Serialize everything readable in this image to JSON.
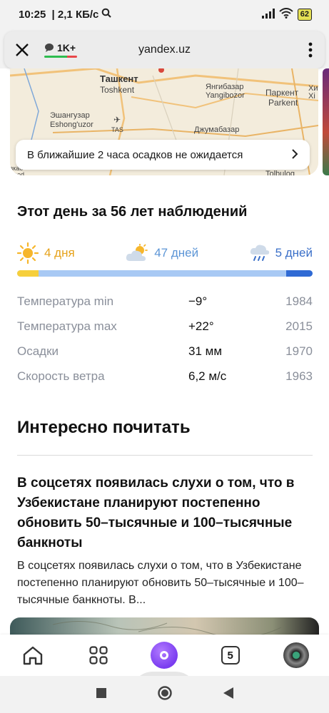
{
  "status_bar": {
    "time": "10:25",
    "speed": "2,1 КБ/с",
    "battery": "62"
  },
  "browser": {
    "comments_count": "1K+",
    "domain": "yandex.uz"
  },
  "map": {
    "labels": {
      "tashkent": "Ташкент",
      "toshkent": "Toshkent",
      "yangibazar": "Янгибазар",
      "yangibozor": "Yangibozor",
      "parkent_ru": "Паркент",
      "parkent": "Parkent",
      "eshangu_ru": "Эшангузар",
      "eshangu": "Eshong'uzor",
      "tas": "TAS",
      "djumabazar": "Джумабазар",
      "xi1": "Хи",
      "xi2": "Xi",
      "kabod": "ɜкаб\nabod",
      "tolbulog": "Tolbulog"
    },
    "precip_text": "В ближайшие 2 часа осадков не ожидается"
  },
  "history": {
    "title": "Этот день за 56 лет наблюдений",
    "stats": [
      {
        "label": "4 дня",
        "kind": "sun",
        "value": 4
      },
      {
        "label": "47 дней",
        "kind": "cloud",
        "value": 47
      },
      {
        "label": "5 дней",
        "kind": "rain",
        "value": 5
      }
    ],
    "records": [
      {
        "label": "Температура min",
        "value": "−9°",
        "year": "1984"
      },
      {
        "label": "Температура max",
        "value": "+22°",
        "year": "2015"
      },
      {
        "label": "Осадки",
        "value": "31 мм",
        "year": "1970"
      },
      {
        "label": "Скорость ветра",
        "value": "6,2 м/с",
        "year": "1963"
      }
    ]
  },
  "reading": {
    "title": "Интересно почитать",
    "article_title": "В соцсетях появилась слухи о том, что в Узбекистане планируют постепенно обновить 50–тысячные и 100–тысячные банкноты",
    "article_text": "В соцсетях появилась слухи о том, что в Узбекистане постепенно планируют обновить 50–тысячные и 100–тысячные банкноты. В..."
  },
  "bottom_nav": {
    "tabs_count": "5"
  },
  "colors": {
    "sun": "#f6cf3c",
    "cloud": "#a8c9f4",
    "rain": "#2f6ad4"
  }
}
